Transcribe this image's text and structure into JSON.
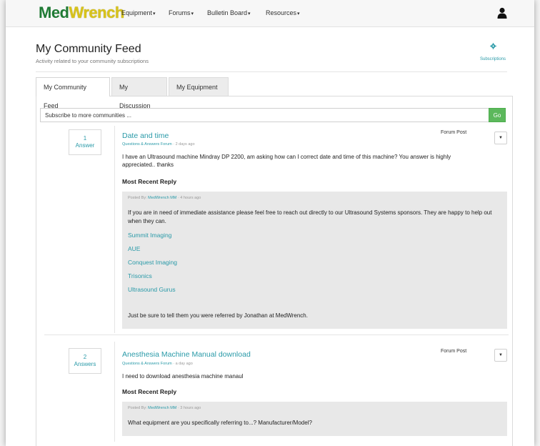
{
  "nav": {
    "logo_part1": "Med",
    "logo_part2": "Wrench",
    "items": [
      {
        "label": "Equipment",
        "caret": "▾"
      },
      {
        "label": "Forums",
        "caret": "▾"
      },
      {
        "label": "Bulletin Board",
        "caret": "▾"
      },
      {
        "label": "Resources",
        "caret": "▾"
      }
    ],
    "user_icon": "user-icon"
  },
  "header": {
    "title": "My Community Feed",
    "subtitle": "Activity related to your community subscriptions",
    "subscriptions_label": "Subscriptions",
    "subscriptions_icon": "gear-icon"
  },
  "tabs": [
    {
      "label": "My Community Feed",
      "active": true
    },
    {
      "label": "My Discussion",
      "active": false
    },
    {
      "label": "My Equipment",
      "active": false
    }
  ],
  "subscribe": {
    "placeholder": "Subscribe to more communities ...",
    "go_label": "Go"
  },
  "feed": [
    {
      "answer_count": "1",
      "answer_label": "Answer",
      "title": "Date and time",
      "forum": "Questions & Answers Forum",
      "age": "2 days ago",
      "type": "Forum Post",
      "body": "I have an Ultrasound machine Mindray DP 2200, am asking how can I correct date and time of this machine? You answer is highly appreciated.. thanks",
      "most_recent_label": "Most Recent Reply",
      "reply": {
        "posted_by_label": "Posted By:",
        "author": "MedWrench MM",
        "age": "4 hours ago",
        "text": "If you are in need of immediate assistance please feel free to reach out directly to our Ultrasound Systems sponsors. They are happy to help out when they can.",
        "links": [
          "Summit Imaging",
          "AUE",
          "Conquest Imaging",
          "Trisonics",
          "Ultrasound Gurus"
        ],
        "footer": "Just be sure to tell them you were referred by Jonathan at MedWrench."
      }
    },
    {
      "answer_count": "2",
      "answer_label": "Answers",
      "title": "Anesthesia Machine Manual download",
      "forum": "Questions & Answers Forum",
      "age": "a day ago",
      "type": "Forum Post",
      "body": "I need to download anesthesia machine manaul",
      "most_recent_label": "Most Recent Reply",
      "reply": {
        "posted_by_label": "Posted By:",
        "author": "MedWrench MM",
        "age": "3 hours ago",
        "text": "What equipment are you specifically referring to...? Manufacturer/Model?"
      }
    }
  ],
  "colors": {
    "accent": "#2a9aa8",
    "go_button": "#5cb85c",
    "logo_green": "#1f7a34",
    "logo_yellow": "#d8c31a",
    "reply_bg": "#e8e8e8"
  }
}
